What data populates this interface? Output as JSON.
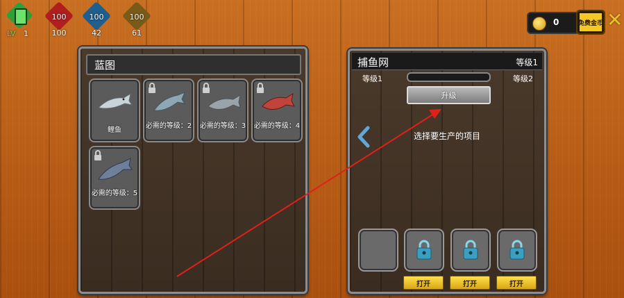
{
  "hud": {
    "level_label": "LV",
    "level_value": "1",
    "stats": [
      {
        "top": "100",
        "bottom": "100",
        "color": "#b01e1e"
      },
      {
        "top": "100",
        "bottom": "42",
        "color": "#1e5f8f"
      },
      {
        "top": "100",
        "bottom": "61",
        "color": "#7a5a18"
      }
    ],
    "coins": "0",
    "free_coins_label": "免费金币"
  },
  "blueprint": {
    "title": "蓝图",
    "items": [
      {
        "label": "鲤鱼",
        "locked": false
      },
      {
        "label": "必需的等级：2",
        "locked": true
      },
      {
        "label": "必需的等级：3",
        "locked": true
      },
      {
        "label": "必需的等级：4",
        "locked": true
      },
      {
        "label": "必需的等级：5",
        "locked": true
      }
    ]
  },
  "net": {
    "title": "捕鱼网",
    "level_label": "等级1",
    "from_level": "等级1",
    "to_level": "等级2",
    "progress": 0,
    "upgrade_label": "升级",
    "prompt": "选择要生产的项目",
    "open_labels": [
      "打开",
      "打开",
      "打开"
    ]
  },
  "colors": {
    "accent_yellow": "#f5c825",
    "annotation_arrow": "#e0201a"
  }
}
